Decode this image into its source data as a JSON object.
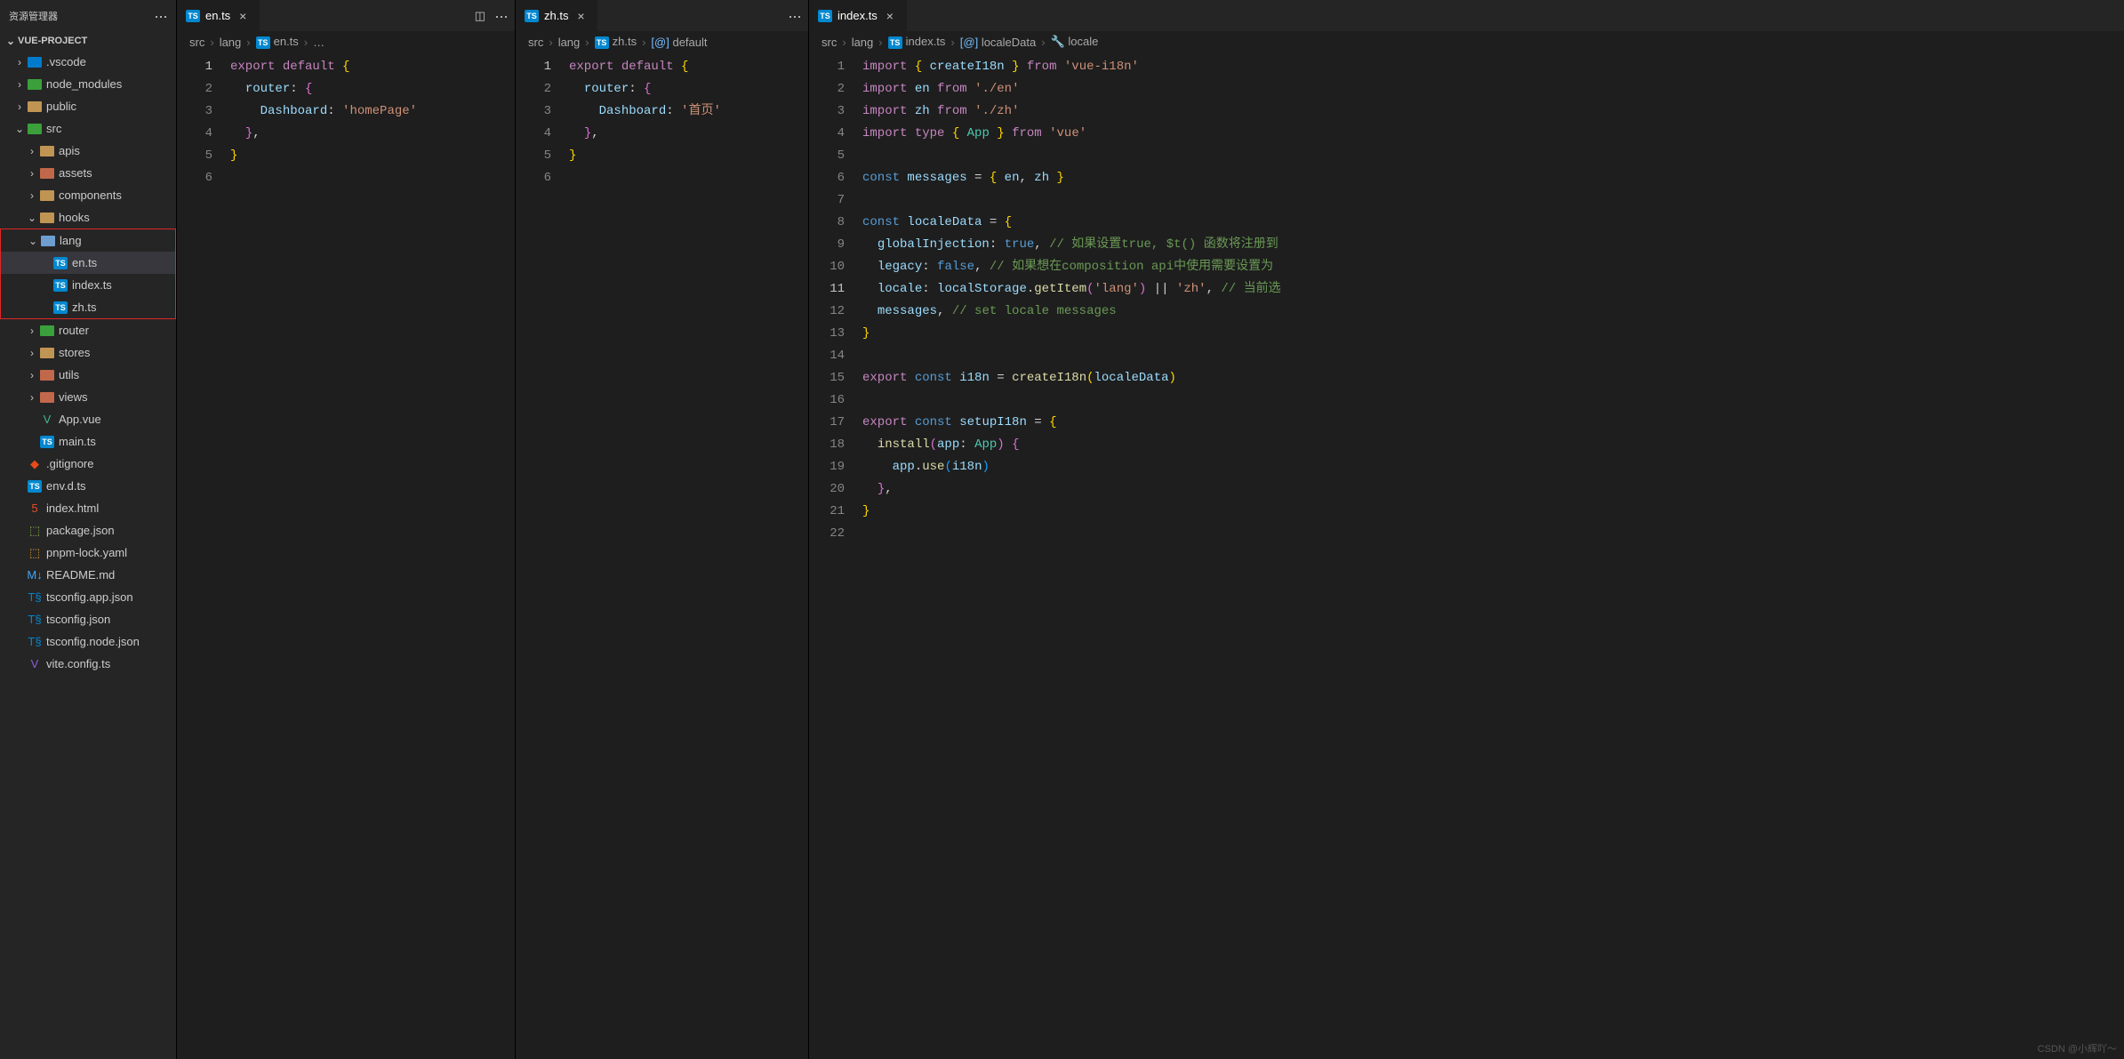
{
  "sidebar": {
    "title": "资源管理器",
    "project": "VUE-PROJECT",
    "tree": [
      {
        "indent": 1,
        "type": "folder",
        "open": false,
        "name": ".vscode",
        "color": "#007acc"
      },
      {
        "indent": 1,
        "type": "folder",
        "open": false,
        "name": "node_modules",
        "color": "#3ba03b"
      },
      {
        "indent": 1,
        "type": "folder",
        "open": false,
        "name": "public",
        "color": "#c09553"
      },
      {
        "indent": 1,
        "type": "folder",
        "open": true,
        "name": "src",
        "color": "#3ba03b"
      },
      {
        "indent": 2,
        "type": "folder",
        "open": false,
        "name": "apis",
        "color": "#c09553"
      },
      {
        "indent": 2,
        "type": "folder",
        "open": false,
        "name": "assets",
        "color": "#c1684b"
      },
      {
        "indent": 2,
        "type": "folder",
        "open": false,
        "name": "components",
        "color": "#c09553"
      },
      {
        "indent": 2,
        "type": "folder",
        "open": true,
        "name": "hooks",
        "color": "#c09553"
      },
      {
        "indent": 2,
        "type": "folder",
        "open": true,
        "name": "lang",
        "color": "#6e9ed0",
        "boxstart": true
      },
      {
        "indent": 3,
        "type": "file",
        "icon": "TS",
        "name": "en.ts",
        "active": true
      },
      {
        "indent": 3,
        "type": "file",
        "icon": "TS",
        "name": "index.ts"
      },
      {
        "indent": 3,
        "type": "file",
        "icon": "TS",
        "name": "zh.ts",
        "boxend": true
      },
      {
        "indent": 2,
        "type": "folder",
        "open": false,
        "name": "router",
        "color": "#3ba03b"
      },
      {
        "indent": 2,
        "type": "folder",
        "open": false,
        "name": "stores",
        "color": "#c09553"
      },
      {
        "indent": 2,
        "type": "folder",
        "open": false,
        "name": "utils",
        "color": "#c1684b"
      },
      {
        "indent": 2,
        "type": "folder",
        "open": false,
        "name": "views",
        "color": "#c1684b"
      },
      {
        "indent": 2,
        "type": "file",
        "icon": "V",
        "name": "App.vue",
        "ic": "#41b883"
      },
      {
        "indent": 2,
        "type": "file",
        "icon": "TS",
        "name": "main.ts"
      },
      {
        "indent": 1,
        "type": "file",
        "icon": "◆",
        "name": ".gitignore",
        "ic": "#e64a19"
      },
      {
        "indent": 1,
        "type": "file",
        "icon": "TS",
        "name": "env.d.ts"
      },
      {
        "indent": 1,
        "type": "file",
        "icon": "5",
        "name": "index.html",
        "ic": "#e44d26"
      },
      {
        "indent": 1,
        "type": "file",
        "icon": "⬚",
        "name": "package.json",
        "ic": "#8bc34a"
      },
      {
        "indent": 1,
        "type": "file",
        "icon": "⬚",
        "name": "pnpm-lock.yaml",
        "ic": "#f9a825"
      },
      {
        "indent": 1,
        "type": "file",
        "icon": "M↓",
        "name": "README.md",
        "ic": "#42a5f5"
      },
      {
        "indent": 1,
        "type": "file",
        "icon": "T§",
        "name": "tsconfig.app.json",
        "ic": "#0288d1"
      },
      {
        "indent": 1,
        "type": "file",
        "icon": "T§",
        "name": "tsconfig.json",
        "ic": "#0288d1"
      },
      {
        "indent": 1,
        "type": "file",
        "icon": "T§",
        "name": "tsconfig.node.json",
        "ic": "#0288d1"
      },
      {
        "indent": 1,
        "type": "file",
        "icon": "V",
        "name": "vite.config.ts",
        "ic": "#8c5fd9"
      }
    ]
  },
  "groups": [
    {
      "tabs": [
        {
          "icon": "TS",
          "label": "en.ts",
          "active": true
        }
      ],
      "actions": [
        "split",
        "more"
      ],
      "crumbs": [
        "src",
        "lang",
        "TS:en.ts",
        "…"
      ],
      "lines": 6,
      "highlight_line": 1,
      "code": [
        [
          [
            "c-kw",
            "export"
          ],
          [
            "c-def",
            " "
          ],
          [
            "c-kw",
            "default"
          ],
          [
            "c-def",
            " "
          ],
          [
            "c-br-y",
            "{"
          ]
        ],
        [
          [
            "c-def",
            "  "
          ],
          [
            "c-prop",
            "router"
          ],
          [
            "c-punc",
            ":"
          ],
          [
            "c-def",
            " "
          ],
          [
            "c-br-p",
            "{"
          ]
        ],
        [
          [
            "c-def",
            "    "
          ],
          [
            "c-prop",
            "Dashboard"
          ],
          [
            "c-punc",
            ":"
          ],
          [
            "c-def",
            " "
          ],
          [
            "c-str",
            "'homePage'"
          ]
        ],
        [
          [
            "c-def",
            "  "
          ],
          [
            "c-br-p",
            "}"
          ],
          [
            "c-punc",
            ","
          ]
        ],
        [
          [
            "c-br-y",
            "}"
          ]
        ],
        []
      ]
    },
    {
      "tabs": [
        {
          "icon": "TS",
          "label": "zh.ts",
          "active": true
        }
      ],
      "actions": [
        "more"
      ],
      "crumbs": [
        "src",
        "lang",
        "TS:zh.ts",
        "[@]:default"
      ],
      "lines": 6,
      "highlight_line": 1,
      "code": [
        [
          [
            "c-kw",
            "export"
          ],
          [
            "c-def",
            " "
          ],
          [
            "c-kw",
            "default"
          ],
          [
            "c-def",
            " "
          ],
          [
            "c-br-y",
            "{"
          ]
        ],
        [
          [
            "c-def",
            "  "
          ],
          [
            "c-prop",
            "router"
          ],
          [
            "c-punc",
            ":"
          ],
          [
            "c-def",
            " "
          ],
          [
            "c-br-p",
            "{"
          ]
        ],
        [
          [
            "c-def",
            "    "
          ],
          [
            "c-prop",
            "Dashboard"
          ],
          [
            "c-punc",
            ":"
          ],
          [
            "c-def",
            " "
          ],
          [
            "c-str",
            "'首页'"
          ]
        ],
        [
          [
            "c-def",
            "  "
          ],
          [
            "c-br-p",
            "}"
          ],
          [
            "c-punc",
            ","
          ]
        ],
        [
          [
            "c-br-y",
            "}"
          ]
        ],
        []
      ]
    },
    {
      "tabs": [
        {
          "icon": "TS",
          "label": "index.ts",
          "active": true
        }
      ],
      "actions": [],
      "crumbs": [
        "src",
        "lang",
        "TS:index.ts",
        "[@]:localeData",
        "🔧:locale"
      ],
      "lines": 22,
      "highlight_line": 11,
      "code": [
        [
          [
            "c-kw",
            "import"
          ],
          [
            "c-def",
            " "
          ],
          [
            "c-br-y",
            "{"
          ],
          [
            "c-def",
            " "
          ],
          [
            "c-prop",
            "createI18n"
          ],
          [
            "c-def",
            " "
          ],
          [
            "c-br-y",
            "}"
          ],
          [
            "c-def",
            " "
          ],
          [
            "c-kw",
            "from"
          ],
          [
            "c-def",
            " "
          ],
          [
            "c-str",
            "'vue-i18n'"
          ]
        ],
        [
          [
            "c-kw",
            "import"
          ],
          [
            "c-def",
            " "
          ],
          [
            "c-prop",
            "en"
          ],
          [
            "c-def",
            " "
          ],
          [
            "c-kw",
            "from"
          ],
          [
            "c-def",
            " "
          ],
          [
            "c-str",
            "'./en'"
          ]
        ],
        [
          [
            "c-kw",
            "import"
          ],
          [
            "c-def",
            " "
          ],
          [
            "c-prop",
            "zh"
          ],
          [
            "c-def",
            " "
          ],
          [
            "c-kw",
            "from"
          ],
          [
            "c-def",
            " "
          ],
          [
            "c-str",
            "'./zh'"
          ]
        ],
        [
          [
            "c-kw",
            "import"
          ],
          [
            "c-def",
            " "
          ],
          [
            "c-kw",
            "type"
          ],
          [
            "c-def",
            " "
          ],
          [
            "c-br-y",
            "{"
          ],
          [
            "c-def",
            " "
          ],
          [
            "c-cls",
            "App"
          ],
          [
            "c-def",
            " "
          ],
          [
            "c-br-y",
            "}"
          ],
          [
            "c-def",
            " "
          ],
          [
            "c-kw",
            "from"
          ],
          [
            "c-def",
            " "
          ],
          [
            "c-str",
            "'vue'"
          ]
        ],
        [],
        [
          [
            "c-bool",
            "const"
          ],
          [
            "c-def",
            " "
          ],
          [
            "c-prop",
            "messages"
          ],
          [
            "c-def",
            " "
          ],
          [
            "c-punc",
            "="
          ],
          [
            "c-def",
            " "
          ],
          [
            "c-br-y",
            "{"
          ],
          [
            "c-def",
            " "
          ],
          [
            "c-prop",
            "en"
          ],
          [
            "c-punc",
            ","
          ],
          [
            "c-def",
            " "
          ],
          [
            "c-prop",
            "zh"
          ],
          [
            "c-def",
            " "
          ],
          [
            "c-br-y",
            "}"
          ]
        ],
        [],
        [
          [
            "c-bool",
            "const"
          ],
          [
            "c-def",
            " "
          ],
          [
            "c-prop",
            "localeData"
          ],
          [
            "c-def",
            " "
          ],
          [
            "c-punc",
            "="
          ],
          [
            "c-def",
            " "
          ],
          [
            "c-br-y",
            "{"
          ]
        ],
        [
          [
            "c-def",
            "  "
          ],
          [
            "c-prop",
            "globalInjection"
          ],
          [
            "c-punc",
            ":"
          ],
          [
            "c-def",
            " "
          ],
          [
            "c-bool",
            "true"
          ],
          [
            "c-punc",
            ","
          ],
          [
            "c-def",
            " "
          ],
          [
            "c-comment",
            "// 如果设置true, $t() 函数将注册到"
          ]
        ],
        [
          [
            "c-def",
            "  "
          ],
          [
            "c-prop",
            "legacy"
          ],
          [
            "c-punc",
            ":"
          ],
          [
            "c-def",
            " "
          ],
          [
            "c-bool",
            "false"
          ],
          [
            "c-punc",
            ","
          ],
          [
            "c-def",
            " "
          ],
          [
            "c-comment",
            "// 如果想在composition api中使用需要设置为"
          ]
        ],
        [
          [
            "c-def",
            "  "
          ],
          [
            "c-prop",
            "locale"
          ],
          [
            "c-punc",
            ":"
          ],
          [
            "c-def",
            " "
          ],
          [
            "c-prop",
            "localStorage"
          ],
          [
            "c-punc",
            "."
          ],
          [
            "c-fn",
            "getItem"
          ],
          [
            "c-br-p",
            "("
          ],
          [
            "c-str",
            "'lang'"
          ],
          [
            "c-br-p",
            ")"
          ],
          [
            "c-def",
            " "
          ],
          [
            "c-punc",
            "||"
          ],
          [
            "c-def",
            " "
          ],
          [
            "c-str",
            "'zh'"
          ],
          [
            "c-punc",
            ","
          ],
          [
            "c-def",
            " "
          ],
          [
            "c-comment",
            "// 当前选"
          ]
        ],
        [
          [
            "c-def",
            "  "
          ],
          [
            "c-prop",
            "messages"
          ],
          [
            "c-punc",
            ","
          ],
          [
            "c-def",
            " "
          ],
          [
            "c-comment",
            "// set locale messages"
          ]
        ],
        [
          [
            "c-br-y",
            "}"
          ]
        ],
        [],
        [
          [
            "c-kw",
            "export"
          ],
          [
            "c-def",
            " "
          ],
          [
            "c-bool",
            "const"
          ],
          [
            "c-def",
            " "
          ],
          [
            "c-prop",
            "i18n"
          ],
          [
            "c-def",
            " "
          ],
          [
            "c-punc",
            "="
          ],
          [
            "c-def",
            " "
          ],
          [
            "c-fn",
            "createI18n"
          ],
          [
            "c-br-y",
            "("
          ],
          [
            "c-prop",
            "localeData"
          ],
          [
            "c-br-y",
            ")"
          ]
        ],
        [],
        [
          [
            "c-kw",
            "export"
          ],
          [
            "c-def",
            " "
          ],
          [
            "c-bool",
            "const"
          ],
          [
            "c-def",
            " "
          ],
          [
            "c-prop",
            "setupI18n"
          ],
          [
            "c-def",
            " "
          ],
          [
            "c-punc",
            "="
          ],
          [
            "c-def",
            " "
          ],
          [
            "c-br-y",
            "{"
          ]
        ],
        [
          [
            "c-def",
            "  "
          ],
          [
            "c-fn",
            "install"
          ],
          [
            "c-br-p",
            "("
          ],
          [
            "c-prop",
            "app"
          ],
          [
            "c-punc",
            ":"
          ],
          [
            "c-def",
            " "
          ],
          [
            "c-cls",
            "App"
          ],
          [
            "c-br-p",
            ")"
          ],
          [
            "c-def",
            " "
          ],
          [
            "c-br-p",
            "{"
          ]
        ],
        [
          [
            "c-def",
            "    "
          ],
          [
            "c-prop",
            "app"
          ],
          [
            "c-punc",
            "."
          ],
          [
            "c-fn",
            "use"
          ],
          [
            "c-br-b",
            "("
          ],
          [
            "c-prop",
            "i18n"
          ],
          [
            "c-br-b",
            ")"
          ]
        ],
        [
          [
            "c-def",
            "  "
          ],
          [
            "c-br-p",
            "}"
          ],
          [
            "c-punc",
            ","
          ]
        ],
        [
          [
            "c-br-y",
            "}"
          ]
        ],
        []
      ]
    }
  ],
  "watermark": "CSDN @小辉吖～"
}
